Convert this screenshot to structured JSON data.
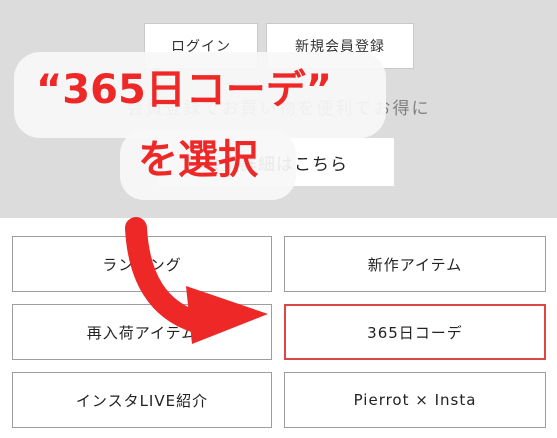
{
  "header": {
    "login_label": "ログイン",
    "register_label": "新規会員登録",
    "benefit_text": "会員登録でお買い物を便利でお得に",
    "details_label": "会員詳細はこちら"
  },
  "annotation": {
    "line1": "“365日コーデ”",
    "line2": "を選択",
    "color": "#ee2727"
  },
  "menu": {
    "items": [
      {
        "label": "ランキング"
      },
      {
        "label": "新作アイテム"
      },
      {
        "label": "再入荷アイテム"
      },
      {
        "label": "365日コーデ"
      },
      {
        "label": "インスタLIVE紹介"
      },
      {
        "label": "Pierrot × Insta"
      }
    ]
  },
  "colors": {
    "highlight_border": "#e04545",
    "band_background": "#dcdcdc"
  }
}
